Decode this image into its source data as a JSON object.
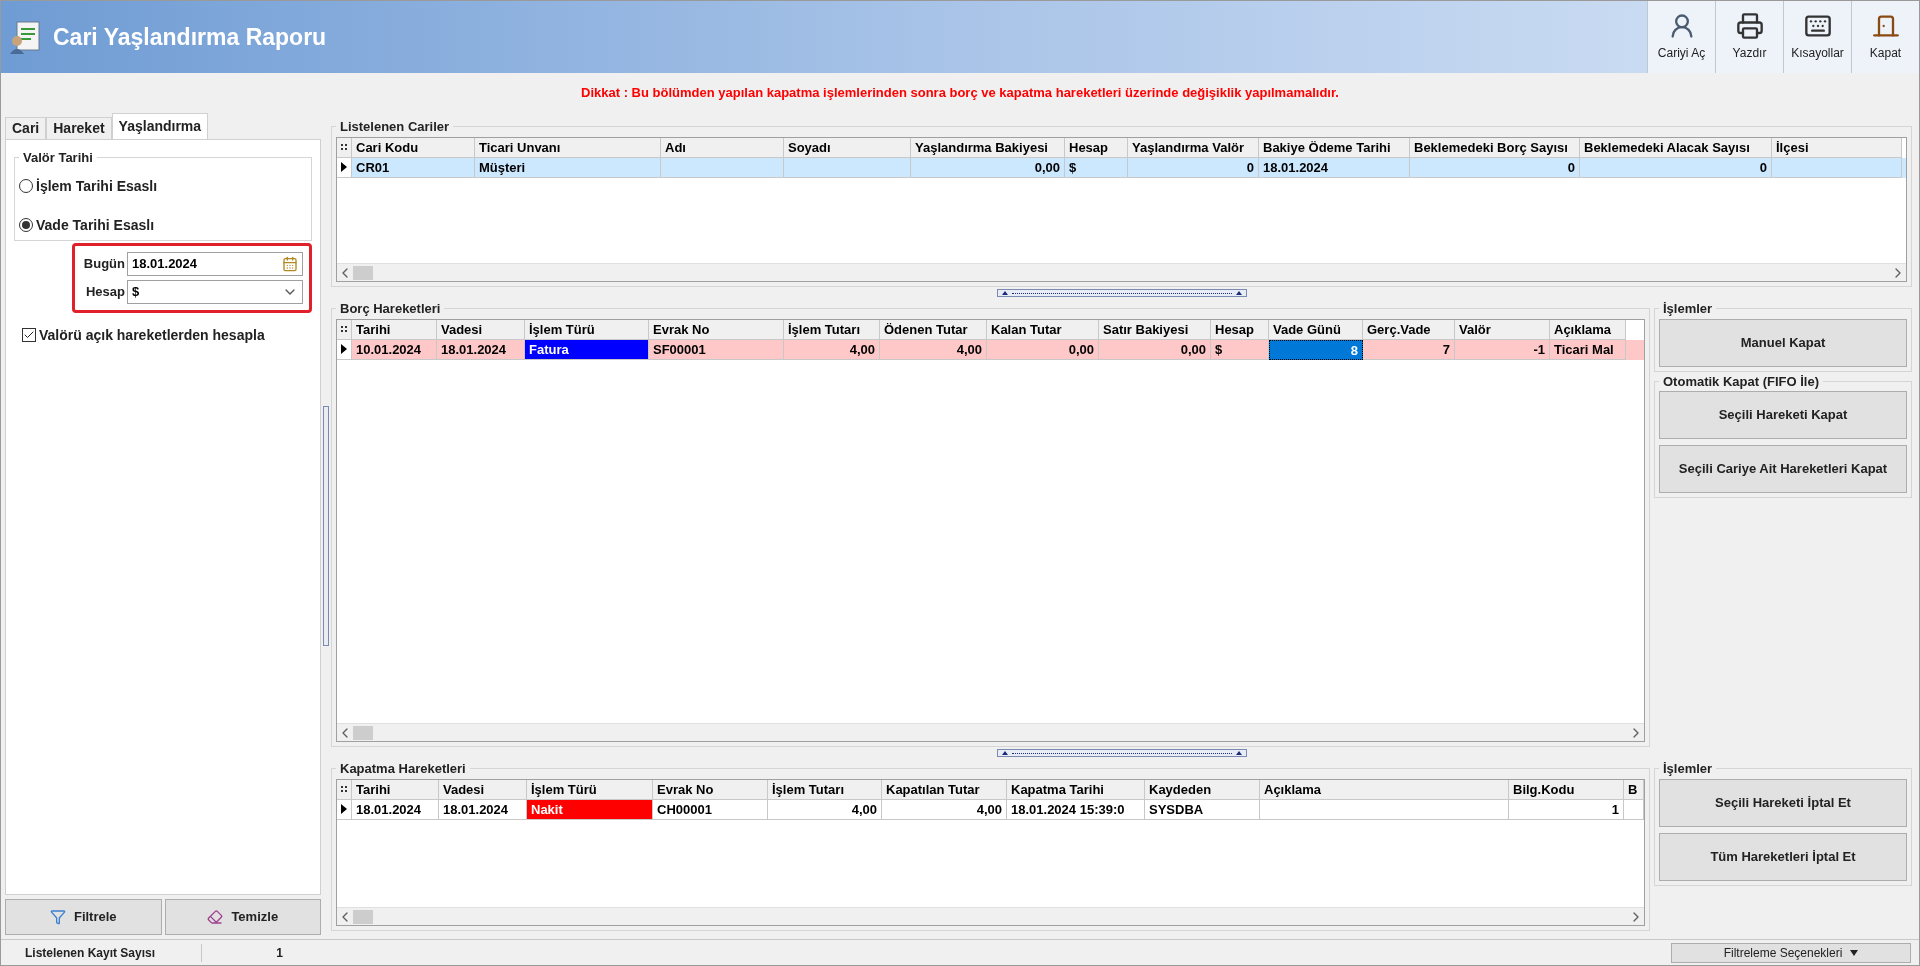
{
  "window": {
    "title": "Cari Yaşlandırma Raporu"
  },
  "toolbar": [
    {
      "label": "Cariyi Aç",
      "kind": "account"
    },
    {
      "label": "Yazdır",
      "kind": "print"
    },
    {
      "label": "Kısayollar",
      "kind": "shortcuts"
    },
    {
      "label": "Kapat",
      "kind": "close"
    }
  ],
  "warning": "Dikkat : Bu bölümden yapılan kapatma işlemlerinden sonra borç ve kapatma hareketleri üzerinde değişiklik yapılmamalıdır.",
  "left_panel": {
    "tabs": [
      {
        "label": "Cari",
        "selected": false
      },
      {
        "label": "Hareket",
        "selected": false
      },
      {
        "label": "Yaşlandırma",
        "selected": true
      }
    ],
    "group": {
      "title": "Valör Tarihi",
      "options": [
        {
          "label": "İşlem Tarihi Esaslı",
          "selected": false
        },
        {
          "label": "Vade Tarihi Esaslı",
          "selected": true
        }
      ]
    },
    "fields": [
      {
        "label": "Bugün",
        "value": "18.01.2024",
        "kind": "date"
      },
      {
        "label": "Hesap",
        "value": "$",
        "kind": "dropdown"
      }
    ],
    "checkbox": {
      "label": "Valörü açık hareketlerden hesapla",
      "checked": true
    },
    "buttons": [
      {
        "label": "Filtrele",
        "kind": "filter"
      },
      {
        "label": "Temizle",
        "kind": "clear"
      }
    ]
  },
  "cari_table": {
    "title": "Listelenen Cariler",
    "columns": [
      {
        "label": "Cari Kodu",
        "numeric": false
      },
      {
        "label": "Ticari Unvanı",
        "numeric": false
      },
      {
        "label": "Adı"
      },
      {
        "label": "Soyadı"
      },
      {
        "label": "Yaşlandırma Bakiyesi",
        "numeric": true
      },
      {
        "label": "Hesap",
        "numeric": false
      },
      {
        "label": "Yaşlandırma Valör",
        "numeric": true
      },
      {
        "label": "Bakiye Ödeme Tarihi",
        "numeric": false
      },
      {
        "label": "Beklemedeki Borç Sayısı",
        "numeric": true
      },
      {
        "label": "Beklemedeki Alacak Sayısı",
        "numeric": true
      },
      {
        "label": "İlçesi"
      }
    ],
    "rows": [
      {
        "selected": true,
        "cells": [
          {
            "text": "CR01"
          },
          {
            "text": "Müşteri"
          },
          {},
          {},
          {
            "text": "0,00"
          },
          {
            "text": "$"
          },
          {
            "text": "0"
          },
          {
            "text": "18.01.2024"
          },
          {
            "text": "0"
          },
          {
            "text": "0"
          },
          {}
        ]
      }
    ]
  },
  "borc_table": {
    "title": "Borç Hareketleri",
    "columns": [
      {
        "label": "Tarihi",
        "numeric": false
      },
      {
        "label": "Vadesi",
        "numeric": false
      },
      {
        "label": "İşlem Türü",
        "numeric": false
      },
      {
        "label": "Evrak No",
        "numeric": false
      },
      {
        "label": "İşlem Tutarı",
        "numeric": true
      },
      {
        "label": "Ödenen Tutar",
        "numeric": true
      },
      {
        "label": "Kalan Tutar",
        "numeric": true
      },
      {
        "label": "Satır Bakiyesi",
        "numeric": true
      },
      {
        "label": "Hesap",
        "numeric": false
      },
      {
        "label": "Vade Günü",
        "numeric": true
      },
      {
        "label": "Gerç.Vade",
        "numeric": true
      },
      {
        "label": "Valör",
        "numeric": true
      },
      {
        "label": "Açıklama",
        "numeric": false
      }
    ],
    "rows": [
      {
        "selected": false,
        "color": "#ffc8c8",
        "cells": [
          {
            "text": "10.01.2024",
            "focused": false
          },
          {
            "text": "18.01.2024",
            "focused": false
          },
          {
            "text": "Fatura",
            "color": "#0000ff",
            "focused": false
          },
          {
            "text": "SF00001",
            "focused": false
          },
          {
            "text": "4,00",
            "focused": false
          },
          {
            "text": "4,00",
            "focused": false
          },
          {
            "text": "0,00",
            "focused": false
          },
          {
            "text": "0,00",
            "focused": false
          },
          {
            "text": "$",
            "focused": false
          },
          {
            "text": "8",
            "focused": true
          },
          {
            "text": "7",
            "focused": false
          },
          {
            "text": "-1",
            "focused": false
          },
          {
            "text": "Ticari Mal",
            "focused": false
          }
        ]
      }
    ]
  },
  "borc_actions": {
    "title": "İşlemler",
    "buttons": [
      "Manuel Kapat"
    ]
  },
  "fifo_actions": {
    "title": "Otomatik Kapat (FIFO İle)",
    "buttons": [
      "Seçili Hareketi Kapat",
      "Seçili Cariye Ait Hareketleri Kapat"
    ]
  },
  "kapatma_table": {
    "title": "Kapatma Hareketleri",
    "columns": [
      {
        "label": "Tarihi",
        "numeric": false
      },
      {
        "label": "Vadesi",
        "numeric": false
      },
      {
        "label": "İşlem Türü",
        "numeric": false
      },
      {
        "label": "Evrak No",
        "numeric": false
      },
      {
        "label": "İşlem Tutarı",
        "numeric": true
      },
      {
        "label": "Kapatılan Tutar",
        "numeric": true
      },
      {
        "label": "Kapatma Tarihi",
        "numeric": false
      },
      {
        "label": "Kaydeden",
        "numeric": false
      },
      {
        "label": "Açıklama"
      },
      {
        "label": "Bilg.Kodu",
        "numeric": true
      },
      {
        "label": "B"
      }
    ],
    "rows": [
      {
        "selected": false,
        "cells": [
          {
            "text": "18.01.2024"
          },
          {
            "text": "18.01.2024"
          },
          {
            "text": "Nakit",
            "color": "#ff0000"
          },
          {
            "text": "CH00001"
          },
          {
            "text": "4,00"
          },
          {
            "text": "4,00"
          },
          {
            "text": "18.01.2024 15:39:0"
          },
          {
            "text": "SYSDBA"
          },
          {},
          {
            "text": "1"
          },
          {}
        ]
      }
    ]
  },
  "kapatma_actions": {
    "title": "İşlemler",
    "buttons": [
      "Seçili Hareketi İptal Et",
      "Tüm Hareketleri İptal Et"
    ]
  },
  "status_bar": {
    "label": "Listelenen Kayıt Sayısı",
    "value": "1",
    "filter_button": "Filtreleme Seçenekleri"
  }
}
